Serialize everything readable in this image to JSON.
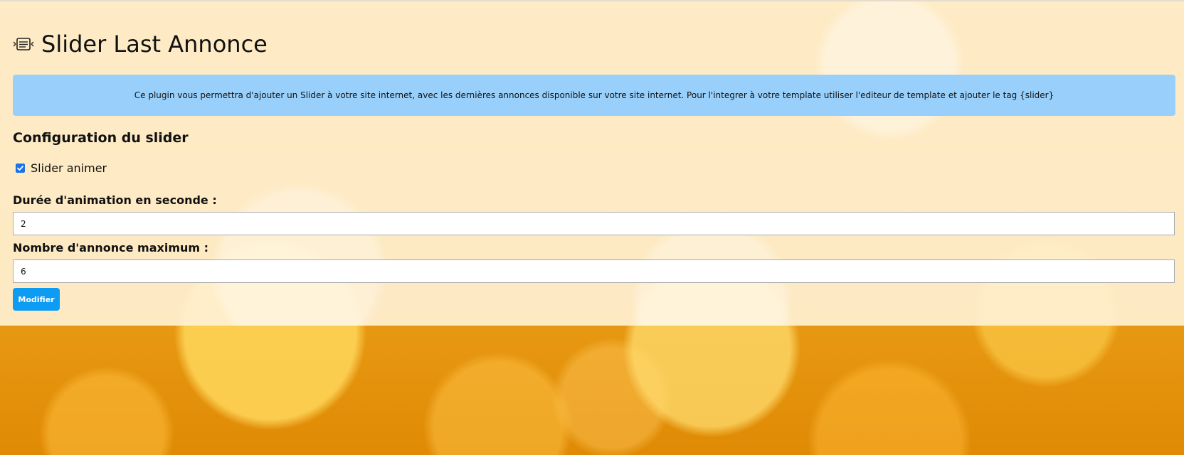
{
  "page": {
    "title": "Slider Last Annonce",
    "title_icon": "slider-icon"
  },
  "info": {
    "text": "Ce plugin vous permettra d'ajouter un Slider à votre site internet, avec les dernières annonces disponible sur votre site internet. Pour l'integrer à votre template utiliser l'editeur de template et ajouter le tag {slider}"
  },
  "config": {
    "section_title": "Configuration du slider",
    "animate_label": "Slider animer",
    "animate_checked": true,
    "duration_label": "Durée d'animation en seconde :",
    "duration_value": "2",
    "max_label": "Nombre d'annonce maximum :",
    "max_value": "6",
    "submit_label": "Modifier"
  },
  "colors": {
    "info_bg": "#99d0fb",
    "button_bg": "#0d9cf4",
    "checkbox": "#1a73e8"
  }
}
